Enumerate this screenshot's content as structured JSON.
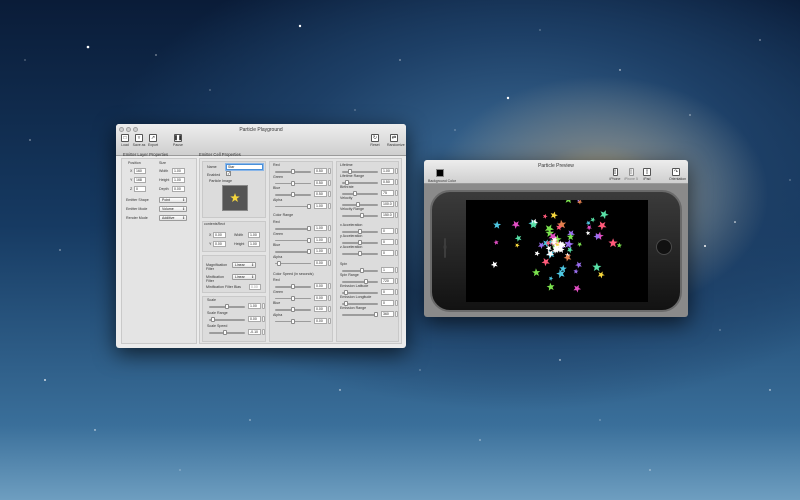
{
  "playground": {
    "title": "Particle Playground",
    "toolbar": {
      "load": "Load",
      "save_as": "Save as",
      "export": "Export",
      "pause": "Pause",
      "reset": "Reset",
      "randomize": "Randomize"
    },
    "emitter": {
      "title": "Emitter Layer Properties",
      "position_label": "Position",
      "size_label": "Size",
      "x_label": "X",
      "x": "160",
      "y_label": "Y",
      "y": "168",
      "z_label": "Z",
      "z": "0",
      "width_label": "Width",
      "width": "1.00",
      "height_label": "Height",
      "height": "1.00",
      "depth_label": "Depth",
      "depth": "0.00",
      "shape_label": "Emitter Shape",
      "shape": "Point",
      "mode_label": "Emitter Mode",
      "mode": "Volume",
      "render_label": "Render Mode",
      "render": "Additive"
    },
    "cell": {
      "title": "Emitter Cell Properties",
      "name_label": "Name",
      "name": "Star",
      "enabled_label": "Enabled",
      "enabled_mark": "✓",
      "image_label": "Particle Image",
      "contents_rect_label": "contentsRect",
      "cx_label": "X",
      "cx": "0.00",
      "cy_label": "Y",
      "cy": "0.00",
      "cw_label": "Width",
      "cw": "1.00",
      "ch_label": "Height",
      "ch": "1.00",
      "mag_label": "Magnification Filter",
      "mag": "Linear",
      "min_label": "Minification Filter",
      "min": "Linear",
      "minbias_label": "Minification Filter Bias",
      "minbias": "0.00",
      "scale": [
        {
          "label": "Scale",
          "value": "1.00",
          "frac": 0.5
        },
        {
          "label": "Scale Range",
          "value": "0.00",
          "frac": 0.05
        },
        {
          "label": "Scale Speed",
          "value": "-0.10",
          "frac": 0.45
        }
      ],
      "color": [
        {
          "label": "Red",
          "value": "0.50",
          "frac": 0.5
        },
        {
          "label": "Green",
          "value": "0.50",
          "frac": 0.5
        },
        {
          "label": "Blue",
          "value": "0.50",
          "frac": 0.5
        },
        {
          "label": "Alpha",
          "value": "1.00",
          "frac": 1.0
        }
      ],
      "color_range_title": "Color Range",
      "color_range": [
        {
          "label": "Red",
          "value": "1.00",
          "frac": 1.0
        },
        {
          "label": "Green",
          "value": "1.00",
          "frac": 1.0
        },
        {
          "label": "Blue",
          "value": "1.00",
          "frac": 1.0
        },
        {
          "label": "Alpha",
          "value": "0.00",
          "frac": 0.05
        }
      ],
      "color_speed_title": "Color Speed (in seconds)",
      "color_speed": [
        {
          "label": "Red",
          "value": "0.00",
          "frac": 0.5
        },
        {
          "label": "Green",
          "value": "0.00",
          "frac": 0.5
        },
        {
          "label": "Blue",
          "value": "0.00",
          "frac": 0.5
        },
        {
          "label": "Alpha",
          "value": "0.00",
          "frac": 0.5
        }
      ],
      "emission1": [
        {
          "label": "Lifetime",
          "value": "1.00",
          "frac": 0.2
        },
        {
          "label": "Lifetime Range",
          "value": "0.50",
          "frac": 0.1
        },
        {
          "label": "Birthrate",
          "value": "75",
          "frac": 0.35
        },
        {
          "label": "Velocity",
          "value": "100.0",
          "frac": 0.45
        },
        {
          "label": "Velocity Range",
          "value": "150.0",
          "frac": 0.55
        }
      ],
      "emission2": [
        {
          "label": "x Acceleration",
          "value": "0",
          "frac": 0.5
        },
        {
          "label": "y Acceleration",
          "value": "0",
          "frac": 0.5
        },
        {
          "label": "z Acceleration",
          "value": "0",
          "frac": 0.5
        }
      ],
      "emission3": [
        {
          "label": "Spin",
          "value": "1",
          "frac": 0.55
        },
        {
          "label": "Spin Range",
          "value": "720",
          "frac": 0.7
        },
        {
          "label": "Emission Latitude",
          "value": "0",
          "frac": 0.05
        },
        {
          "label": "Emission Longitude",
          "value": "0",
          "frac": 0.05
        },
        {
          "label": "Emission Range",
          "value": "360",
          "frac": 1.0
        }
      ]
    }
  },
  "preview": {
    "title": "Particle Preview",
    "bg_label": "Background Color",
    "iphone": "iPhone",
    "iphone5": "iPhone 5",
    "ipad": "iPad",
    "orientation": "Orientation"
  },
  "colors": {
    "accent": "#4a90d9",
    "emitter_highlight": "#ffffff",
    "star_yellow": "#f5d63c"
  }
}
